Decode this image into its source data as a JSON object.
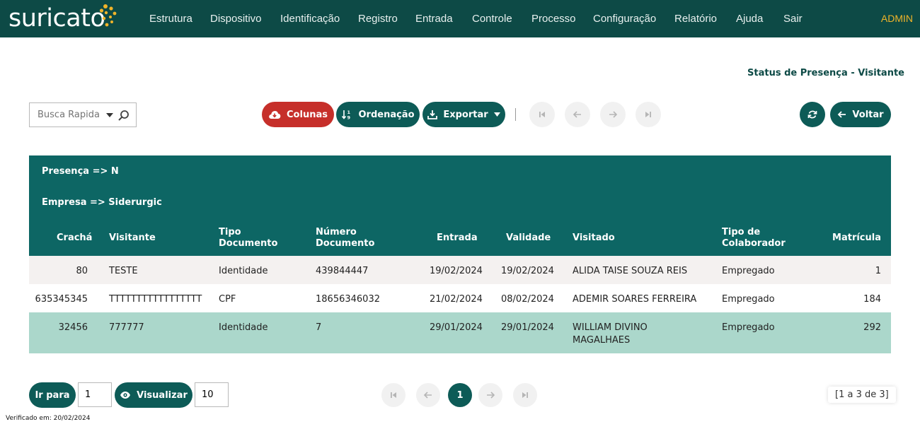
{
  "app": {
    "logo_text": "suricato",
    "admin_label": "ADMIN"
  },
  "nav": {
    "items": [
      "Estrutura",
      "Dispositivo",
      "Identificação",
      "Registro",
      "Entrada",
      "Controle",
      "Processo",
      "Configuração",
      "Relatório",
      "Ajuda",
      "Sair"
    ]
  },
  "page": {
    "title": "Status de Presença - Visitante"
  },
  "toolbar": {
    "search_placeholder": "Busca Rapida",
    "colunas_label": "Colunas",
    "ordenacao_label": "Ordenação",
    "exportar_label": "Exportar",
    "voltar_label": "Voltar"
  },
  "filters": [
    "Presença => N",
    "Empresa => Siderurgic"
  ],
  "table": {
    "columns": {
      "cracha": "Crachá",
      "visitante": "Visitante",
      "tipo_doc_1": "Tipo",
      "tipo_doc_2": "Documento",
      "num_doc_1": "Número",
      "num_doc_2": "Documento",
      "entrada": "Entrada",
      "validade": "Validade",
      "visitado": "Visitado",
      "tipo_colab_1": "Tipo de",
      "tipo_colab_2": "Colaborador",
      "matricula": "Matrícula"
    },
    "rows": [
      {
        "cracha": "80",
        "visitante": "TESTE",
        "tipo_doc": "Identidade",
        "num_doc": "439844447",
        "entrada": "19/02/2024",
        "validade": "19/02/2024",
        "visitado_1": "ALIDA TAISE SOUZA REIS",
        "visitado_2": "",
        "tipo_colab": "Empregado",
        "matricula": "1"
      },
      {
        "cracha": "635345345",
        "visitante": "TTTTTTTTTTTTTTTTT",
        "tipo_doc": "CPF",
        "num_doc": "18656346032",
        "entrada": "21/02/2024",
        "validade": "08/02/2024",
        "visitado_1": "ADEMIR SOARES FERREIRA",
        "visitado_2": "",
        "tipo_colab": "Empregado",
        "matricula": "184"
      },
      {
        "cracha": "32456",
        "visitante": "777777",
        "tipo_doc": "Identidade",
        "num_doc": "7",
        "entrada": "29/01/2024",
        "validade": "29/01/2024",
        "visitado_1": "WILLIAM DIVINO",
        "visitado_2": "MAGALHAES",
        "tipo_colab": "Empregado",
        "matricula": "292"
      }
    ]
  },
  "footer": {
    "ir_para_label": "Ir para",
    "ir_para_value": "1",
    "visualizar_label": "Visualizar",
    "visualizar_value": "10",
    "current_page": "1",
    "range_text": "[1 a 3 de 3]",
    "verified_text": "Verificado em: 20/02/2024"
  },
  "colors": {
    "navbar": "#0d4a46",
    "header": "#0d6664",
    "primary_button": "#0d5b57",
    "danger_button": "#c62f2a",
    "selected_row": "#abd7cb",
    "admin": "#f0b429"
  }
}
